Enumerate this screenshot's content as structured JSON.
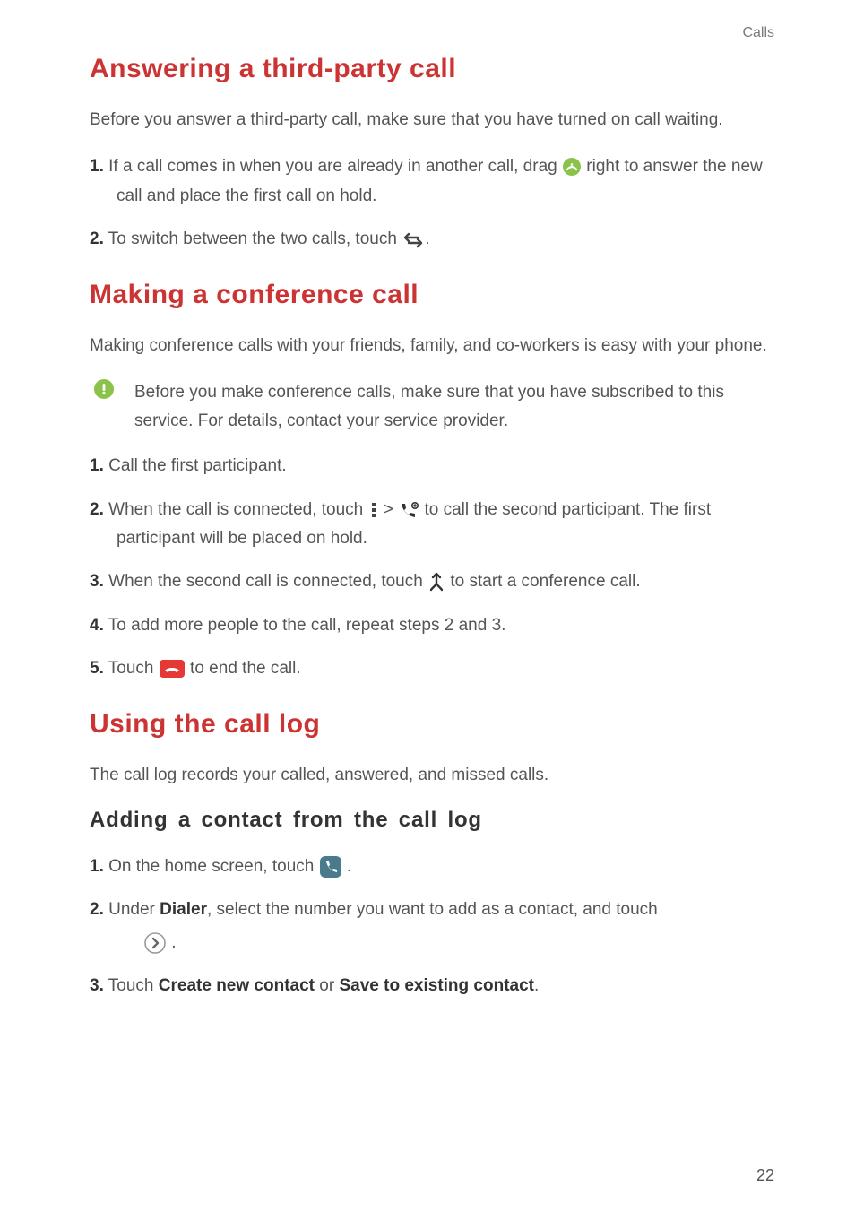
{
  "header": {
    "breadcrumb": "Calls"
  },
  "section1": {
    "title": "Answering a third-party call",
    "intro": "Before you answer a third-party call, make sure that you have turned on call waiting.",
    "step1_num": "1.",
    "step1_a": " If a call comes in when you are already in another call, drag ",
    "step1_b": " right to answer the new call and place the first call on hold.",
    "step2_num": "2.",
    "step2_a": " To switch between the two calls, touch ",
    "step2_b": "."
  },
  "section2": {
    "title": "Making a conference call",
    "intro": "Making conference calls with your friends, family, and co-workers is easy with your phone.",
    "note": "Before you make conference calls, make sure that you have subscribed to this service. For details, contact your service provider.",
    "step1_num": "1.",
    "step1": " Call the first participant.",
    "step2_num": "2.",
    "step2_a": " When the call is connected, touch ",
    "step2_b": " > ",
    "step2_c": " to call the second participant. The first participant will be placed on hold.",
    "step3_num": "3.",
    "step3_a": " When the second call is connected, touch ",
    "step3_b": " to start a conference call.",
    "step4_num": "4.",
    "step4": " To add more people to the call, repeat steps 2 and 3.",
    "step5_num": "5.",
    "step5_a": " Touch ",
    "step5_b": " to end the call."
  },
  "section3": {
    "title": "Using the call log",
    "intro": "The call log records your called, answered, and missed calls.",
    "sub1": {
      "title": "Adding a contact from the call log",
      "step1_num": "1.",
      "step1_a": " On the home screen, touch ",
      "step1_b": " .",
      "step2_num": "2.",
      "step2_a": " Under ",
      "step2_bold": "Dialer",
      "step2_b": ", select the number you want to add as a contact, and touch ",
      "step2_c": " .",
      "step3_num": "3.",
      "step3_a": " Touch ",
      "step3_bold1": "Create new contact",
      "step3_b": " or ",
      "step3_bold2": "Save to existing contact",
      "step3_c": "."
    }
  },
  "page_number": "22"
}
